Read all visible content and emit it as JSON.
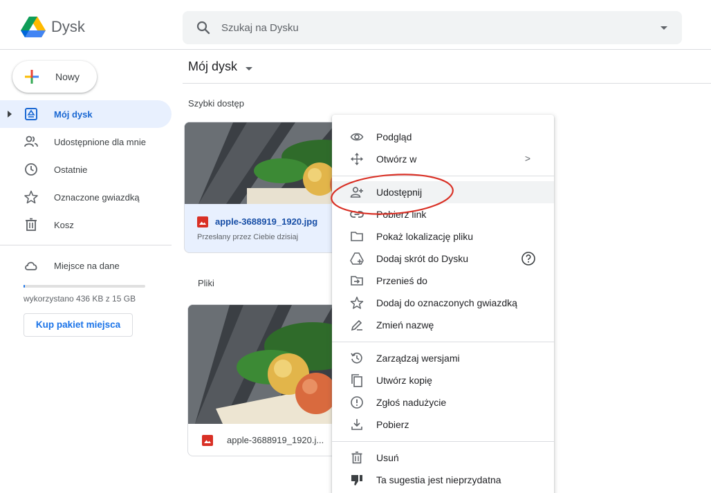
{
  "header": {
    "app_name": "Dysk",
    "search_placeholder": "Szukaj na Dysku"
  },
  "sidebar": {
    "new_label": "Nowy",
    "items": [
      {
        "label": "Mój dysk",
        "icon": "my-drive-icon",
        "active": true
      },
      {
        "label": "Udostępnione dla mnie",
        "icon": "shared-icon"
      },
      {
        "label": "Ostatnie",
        "icon": "clock-icon"
      },
      {
        "label": "Oznaczone gwiazdką",
        "icon": "star-icon"
      },
      {
        "label": "Kosz",
        "icon": "trash-icon"
      }
    ],
    "storage": {
      "label": "Miejsce na dane",
      "usage_text": "wykorzystano 436 KB z 15 GB",
      "used_fraction": 0.01,
      "buy_label": "Kup pakiet miejsca"
    }
  },
  "main": {
    "breadcrumb": "Mój dysk",
    "quick_access_label": "Szybki dostęp",
    "quick_access_file": {
      "name": "apple-3688919_1920.jpg",
      "subtitle": "Przesłany przez Ciebie dzisiaj"
    },
    "files_label": "Pliki",
    "file": {
      "name": "apple-3688919_1920.j..."
    }
  },
  "context_menu": {
    "items": [
      {
        "label": "Podgląd",
        "icon": "eye-icon"
      },
      {
        "label": "Otwórz w",
        "icon": "open-with-icon",
        "submenu": ">"
      },
      {
        "label": "Udostępnij",
        "icon": "share-person-icon",
        "highlighted": true
      },
      {
        "label": "Pobierz link",
        "icon": "link-icon"
      },
      {
        "label": "Pokaż lokalizację pliku",
        "icon": "folder-icon"
      },
      {
        "label": "Dodaj skrót do Dysku",
        "icon": "add-shortcut-icon",
        "help": true
      },
      {
        "label": "Przenieś do",
        "icon": "move-to-icon"
      },
      {
        "label": "Dodaj do oznaczonych gwiazdką",
        "icon": "star-icon"
      },
      {
        "label": "Zmień nazwę",
        "icon": "pencil-icon"
      },
      {
        "label": "Zarządzaj wersjami",
        "icon": "history-icon"
      },
      {
        "label": "Utwórz kopię",
        "icon": "copy-icon"
      },
      {
        "label": "Zgłoś nadużycie",
        "icon": "report-icon"
      },
      {
        "label": "Pobierz",
        "icon": "download-icon"
      },
      {
        "label": "Usuń",
        "icon": "trash-icon"
      },
      {
        "label": "Ta sugestia jest nieprzydatna",
        "icon": "thumbs-down-icon"
      }
    ]
  },
  "colors": {
    "accent": "#1a73e8",
    "active_bg": "#e8f0fe",
    "annotation": "#d93025"
  }
}
